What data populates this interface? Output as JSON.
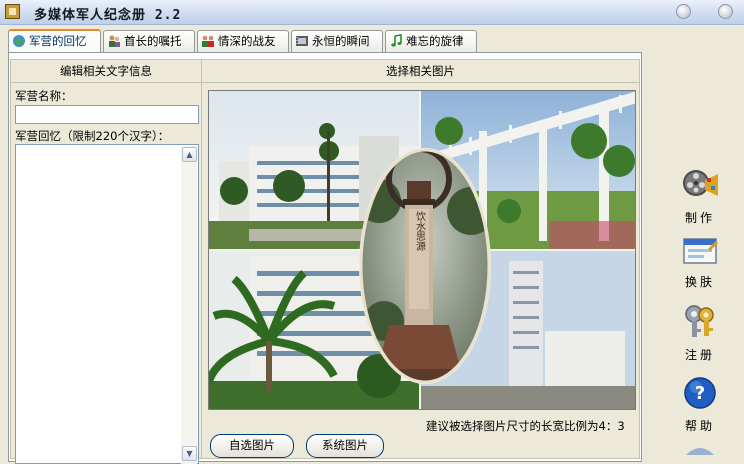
{
  "window": {
    "title": "多媒体军人纪念册 2.2"
  },
  "tabs": [
    {
      "label": "军营的回忆",
      "icon": "globe-icon",
      "active": true
    },
    {
      "label": "首长的嘱托",
      "icon": "people-icon",
      "active": false
    },
    {
      "label": "情深的战友",
      "icon": "comrades-icon",
      "active": false
    },
    {
      "label": "永恒的瞬间",
      "icon": "film-icon",
      "active": false
    },
    {
      "label": "难忘的旋律",
      "icon": "music-note-icon",
      "active": false
    }
  ],
  "left_section": {
    "header": "编辑相关文字信息",
    "name_label": "军营名称：",
    "name_value": "",
    "memory_label": "军营回忆（限制220个汉字）：",
    "memory_value": ""
  },
  "right_section": {
    "header": "选择相关图片",
    "hint": "建议被选择图片尺寸的长宽比例为4：3",
    "select_button": "自选图片",
    "system_button": "系统图片",
    "monument_text": "饮水思源"
  },
  "toolbar": [
    {
      "label": "制作",
      "icon": "film-reel-icon"
    },
    {
      "label": "换肤",
      "icon": "skin-palette-icon"
    },
    {
      "label": "注册",
      "icon": "keys-icon"
    },
    {
      "label": "帮助",
      "icon": "help-icon"
    }
  ],
  "colors": {
    "tab_accent": "#E68B2C",
    "help_blue": "#1F5FC4"
  }
}
